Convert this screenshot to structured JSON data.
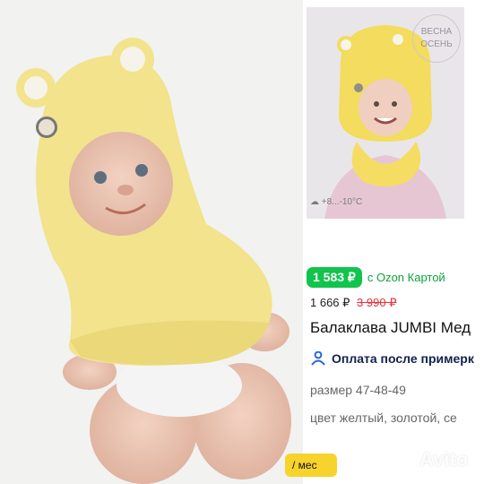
{
  "badge": {
    "line1": "ВЕСНА",
    "line2": "ОСЕНЬ"
  },
  "temperature": "+8...-10°C",
  "price": {
    "current": "1 583 ₽",
    "card_note": "с Ozon Картой",
    "regular": "1 666 ₽",
    "old": "3 990 ₽"
  },
  "product": {
    "title": "Балаклава JUMBI Мед",
    "payment": "Оплата после примерк",
    "size": "размер 47-48-49",
    "color": "цвет желтый, золотой, се"
  },
  "installment": "/ мес",
  "watermark": "Avito",
  "colors": {
    "price_green": "#10c44c",
    "strike_red": "#e5323d",
    "accent_yellow": "#f7d32c"
  }
}
